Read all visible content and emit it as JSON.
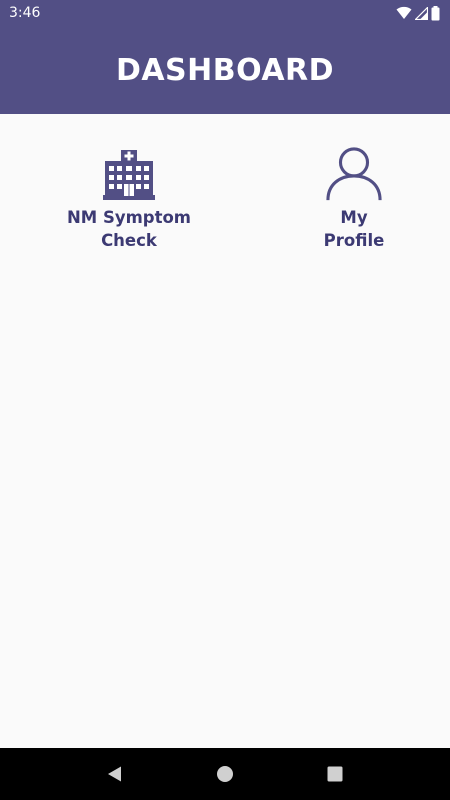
{
  "status_bar": {
    "time": "3:46",
    "icons": [
      "wifi-icon",
      "signal-icon",
      "battery-icon"
    ]
  },
  "app_bar": {
    "title": "DASHBOARD",
    "background": "#524f85"
  },
  "tiles": [
    {
      "label": "NM Symptom\nCheck",
      "icon": "hospital-icon"
    },
    {
      "label": "My\nProfile",
      "icon": "person-icon"
    }
  ],
  "nav_bar": {
    "buttons": [
      "back-icon",
      "home-icon",
      "recents-icon"
    ]
  },
  "colors": {
    "accent": "#524f85",
    "label": "#3c3a73",
    "background": "#fafafa"
  }
}
